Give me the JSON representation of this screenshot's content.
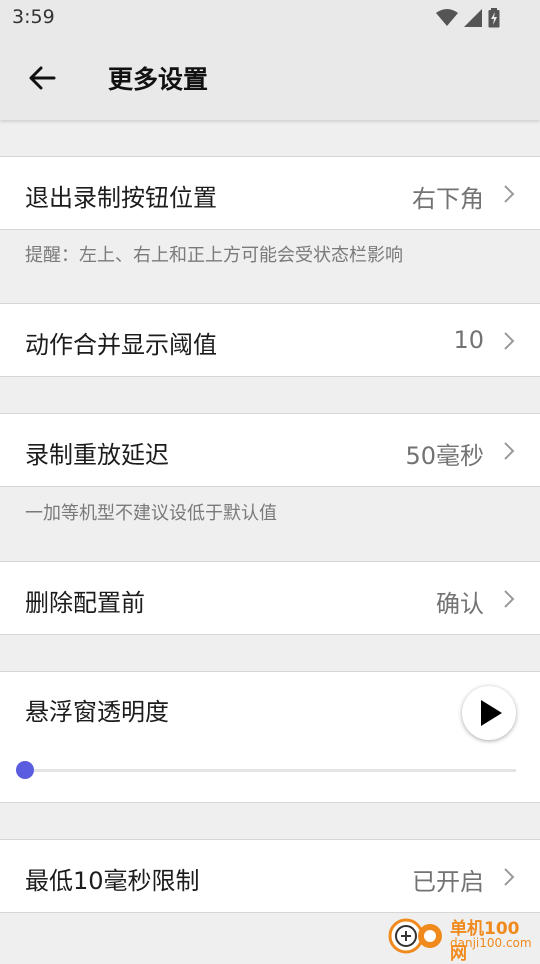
{
  "status_bar": {
    "time": "3:59",
    "icons": [
      "wifi-icon",
      "cell-signal-icon",
      "battery-charging-icon"
    ]
  },
  "app_bar": {
    "title": "更多设置",
    "back_icon": "arrow-left-icon"
  },
  "settings": {
    "exit_button_position": {
      "label": "退出录制按钮位置",
      "value": "右下角",
      "note": "提醒：左上、右上和正上方可能会受状态栏影响"
    },
    "merge_threshold": {
      "label": "动作合并显示阈值",
      "value": "10"
    },
    "replay_delay": {
      "label": "录制重放延迟",
      "value": "50毫秒",
      "note": "一加等机型不建议设低于默认值"
    },
    "confirm_before_delete": {
      "label": "删除配置前",
      "value": "确认"
    },
    "float_window_opacity": {
      "label": "悬浮窗透明度",
      "slider_value": 0
    },
    "min_10ms_limit": {
      "label": "最低10毫秒限制",
      "value": "已开启"
    }
  },
  "watermark": {
    "text": "单机100网",
    "url": "danji100.com"
  },
  "colors": {
    "accent": "#5a5de0",
    "background": "#efefef",
    "watermark": "#f08a1c"
  }
}
